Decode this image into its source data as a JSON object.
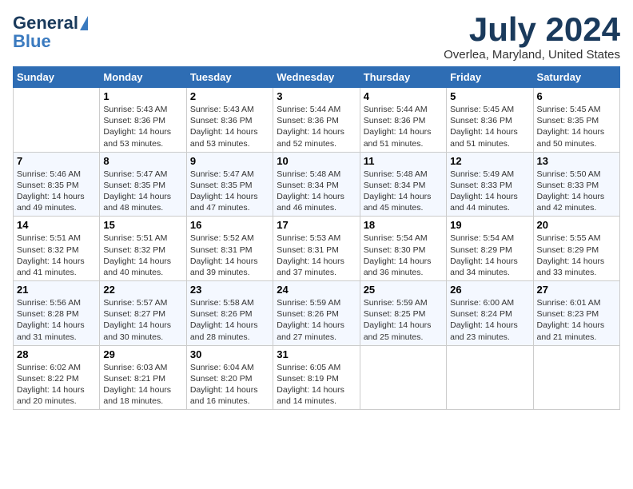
{
  "header": {
    "logo_line1": "General",
    "logo_line2": "Blue",
    "month": "July 2024",
    "location": "Overlea, Maryland, United States"
  },
  "weekdays": [
    "Sunday",
    "Monday",
    "Tuesday",
    "Wednesday",
    "Thursday",
    "Friday",
    "Saturday"
  ],
  "weeks": [
    [
      {
        "day": "",
        "content": ""
      },
      {
        "day": "1",
        "content": "Sunrise: 5:43 AM\nSunset: 8:36 PM\nDaylight: 14 hours\nand 53 minutes."
      },
      {
        "day": "2",
        "content": "Sunrise: 5:43 AM\nSunset: 8:36 PM\nDaylight: 14 hours\nand 53 minutes."
      },
      {
        "day": "3",
        "content": "Sunrise: 5:44 AM\nSunset: 8:36 PM\nDaylight: 14 hours\nand 52 minutes."
      },
      {
        "day": "4",
        "content": "Sunrise: 5:44 AM\nSunset: 8:36 PM\nDaylight: 14 hours\nand 51 minutes."
      },
      {
        "day": "5",
        "content": "Sunrise: 5:45 AM\nSunset: 8:36 PM\nDaylight: 14 hours\nand 51 minutes."
      },
      {
        "day": "6",
        "content": "Sunrise: 5:45 AM\nSunset: 8:35 PM\nDaylight: 14 hours\nand 50 minutes."
      }
    ],
    [
      {
        "day": "7",
        "content": "Sunrise: 5:46 AM\nSunset: 8:35 PM\nDaylight: 14 hours\nand 49 minutes."
      },
      {
        "day": "8",
        "content": "Sunrise: 5:47 AM\nSunset: 8:35 PM\nDaylight: 14 hours\nand 48 minutes."
      },
      {
        "day": "9",
        "content": "Sunrise: 5:47 AM\nSunset: 8:35 PM\nDaylight: 14 hours\nand 47 minutes."
      },
      {
        "day": "10",
        "content": "Sunrise: 5:48 AM\nSunset: 8:34 PM\nDaylight: 14 hours\nand 46 minutes."
      },
      {
        "day": "11",
        "content": "Sunrise: 5:48 AM\nSunset: 8:34 PM\nDaylight: 14 hours\nand 45 minutes."
      },
      {
        "day": "12",
        "content": "Sunrise: 5:49 AM\nSunset: 8:33 PM\nDaylight: 14 hours\nand 44 minutes."
      },
      {
        "day": "13",
        "content": "Sunrise: 5:50 AM\nSunset: 8:33 PM\nDaylight: 14 hours\nand 42 minutes."
      }
    ],
    [
      {
        "day": "14",
        "content": "Sunrise: 5:51 AM\nSunset: 8:32 PM\nDaylight: 14 hours\nand 41 minutes."
      },
      {
        "day": "15",
        "content": "Sunrise: 5:51 AM\nSunset: 8:32 PM\nDaylight: 14 hours\nand 40 minutes."
      },
      {
        "day": "16",
        "content": "Sunrise: 5:52 AM\nSunset: 8:31 PM\nDaylight: 14 hours\nand 39 minutes."
      },
      {
        "day": "17",
        "content": "Sunrise: 5:53 AM\nSunset: 8:31 PM\nDaylight: 14 hours\nand 37 minutes."
      },
      {
        "day": "18",
        "content": "Sunrise: 5:54 AM\nSunset: 8:30 PM\nDaylight: 14 hours\nand 36 minutes."
      },
      {
        "day": "19",
        "content": "Sunrise: 5:54 AM\nSunset: 8:29 PM\nDaylight: 14 hours\nand 34 minutes."
      },
      {
        "day": "20",
        "content": "Sunrise: 5:55 AM\nSunset: 8:29 PM\nDaylight: 14 hours\nand 33 minutes."
      }
    ],
    [
      {
        "day": "21",
        "content": "Sunrise: 5:56 AM\nSunset: 8:28 PM\nDaylight: 14 hours\nand 31 minutes."
      },
      {
        "day": "22",
        "content": "Sunrise: 5:57 AM\nSunset: 8:27 PM\nDaylight: 14 hours\nand 30 minutes."
      },
      {
        "day": "23",
        "content": "Sunrise: 5:58 AM\nSunset: 8:26 PM\nDaylight: 14 hours\nand 28 minutes."
      },
      {
        "day": "24",
        "content": "Sunrise: 5:59 AM\nSunset: 8:26 PM\nDaylight: 14 hours\nand 27 minutes."
      },
      {
        "day": "25",
        "content": "Sunrise: 5:59 AM\nSunset: 8:25 PM\nDaylight: 14 hours\nand 25 minutes."
      },
      {
        "day": "26",
        "content": "Sunrise: 6:00 AM\nSunset: 8:24 PM\nDaylight: 14 hours\nand 23 minutes."
      },
      {
        "day": "27",
        "content": "Sunrise: 6:01 AM\nSunset: 8:23 PM\nDaylight: 14 hours\nand 21 minutes."
      }
    ],
    [
      {
        "day": "28",
        "content": "Sunrise: 6:02 AM\nSunset: 8:22 PM\nDaylight: 14 hours\nand 20 minutes."
      },
      {
        "day": "29",
        "content": "Sunrise: 6:03 AM\nSunset: 8:21 PM\nDaylight: 14 hours\nand 18 minutes."
      },
      {
        "day": "30",
        "content": "Sunrise: 6:04 AM\nSunset: 8:20 PM\nDaylight: 14 hours\nand 16 minutes."
      },
      {
        "day": "31",
        "content": "Sunrise: 6:05 AM\nSunset: 8:19 PM\nDaylight: 14 hours\nand 14 minutes."
      },
      {
        "day": "",
        "content": ""
      },
      {
        "day": "",
        "content": ""
      },
      {
        "day": "",
        "content": ""
      }
    ]
  ]
}
